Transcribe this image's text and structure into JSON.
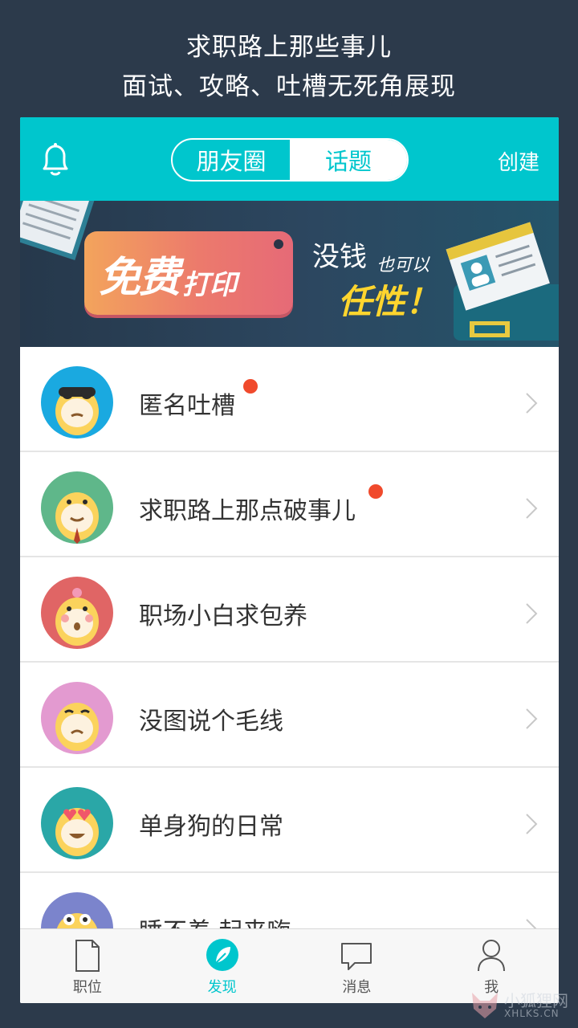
{
  "promo": {
    "line1": "求职路上那些事儿",
    "line2": "面试、攻略、吐槽无死角展现"
  },
  "header": {
    "segments": [
      "朋友圈",
      "话题"
    ],
    "active_segment": "话题",
    "create_label": "创建"
  },
  "banner": {
    "tag_big": "免费",
    "tag_small": "打印",
    "line1": "没钱",
    "line1_small": "也可以",
    "line2": "任性！"
  },
  "topics": [
    {
      "label": "匿名吐槽",
      "unread": true,
      "avatar_bg": "#1aa9e0"
    },
    {
      "label": "求职路上那点破事儿",
      "unread": true,
      "avatar_bg": "#5fb78a"
    },
    {
      "label": "职场小白求包养",
      "unread": false,
      "avatar_bg": "#e06565"
    },
    {
      "label": "没图说个毛线",
      "unread": false,
      "avatar_bg": "#e39ad0"
    },
    {
      "label": "单身狗的日常",
      "unread": false,
      "avatar_bg": "#2aa7a7"
    },
    {
      "label": "睡不着 起来嗨",
      "unread": false,
      "avatar_bg": "#7b84cc"
    }
  ],
  "tabs": [
    {
      "label": "职位",
      "icon": "document-icon",
      "active": false
    },
    {
      "label": "发现",
      "icon": "compass-leaf-icon",
      "active": true
    },
    {
      "label": "消息",
      "icon": "chat-bubble-icon",
      "active": false
    },
    {
      "label": "我",
      "icon": "person-icon",
      "active": false
    }
  ],
  "watermark": {
    "cn": "小狐狸网",
    "en": "XHLKS.CN"
  },
  "colors": {
    "accent": "#00c6cd",
    "background": "#2c3a4b",
    "badge": "#f04a2c"
  }
}
